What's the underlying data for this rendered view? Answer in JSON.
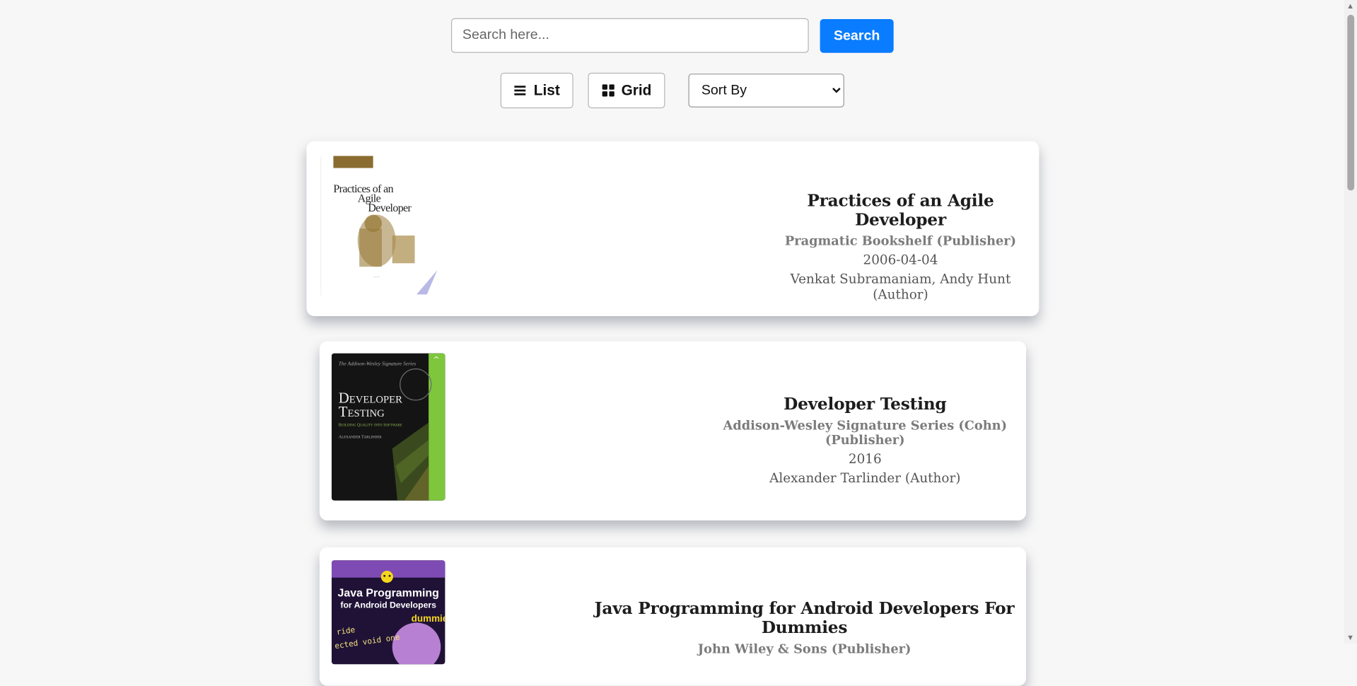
{
  "search": {
    "placeholder": "Search here...",
    "button_label": "Search"
  },
  "view": {
    "list_label": "List",
    "grid_label": "Grid"
  },
  "sort": {
    "selected": "Sort By"
  },
  "books": [
    {
      "title": "Practices of an Agile Developer",
      "publisher": "Pragmatic Bookshelf (Publisher)",
      "date": "2006-04-04",
      "authors": "Venkat Subramaniam, Andy Hunt (Author)",
      "cover": {
        "title_lines": [
          "Practices of an",
          "Agile",
          "Developer"
        ]
      }
    },
    {
      "title": "Developer Testing",
      "publisher": "Addison-Wesley Signature Series (Cohn) (Publisher)",
      "date": "2016",
      "authors": "Alexander Tarlinder (Author)",
      "cover": {
        "series": "The Addison-Wesley Signature Series",
        "title_lines": [
          "Developer",
          "Testing"
        ],
        "subtitle": "Building Quality into Software",
        "author": "Alexander Tarlinder"
      }
    },
    {
      "title": "Java Programming for Android Developers For Dummies",
      "publisher": "John Wiley & Sons (Publisher)",
      "cover": {
        "title_lines": [
          "Java Programming",
          "for Android Developers"
        ],
        "brand": "dummies"
      }
    }
  ],
  "colors": {
    "accent": "#0a7cff",
    "background": "#f7f7f7"
  }
}
